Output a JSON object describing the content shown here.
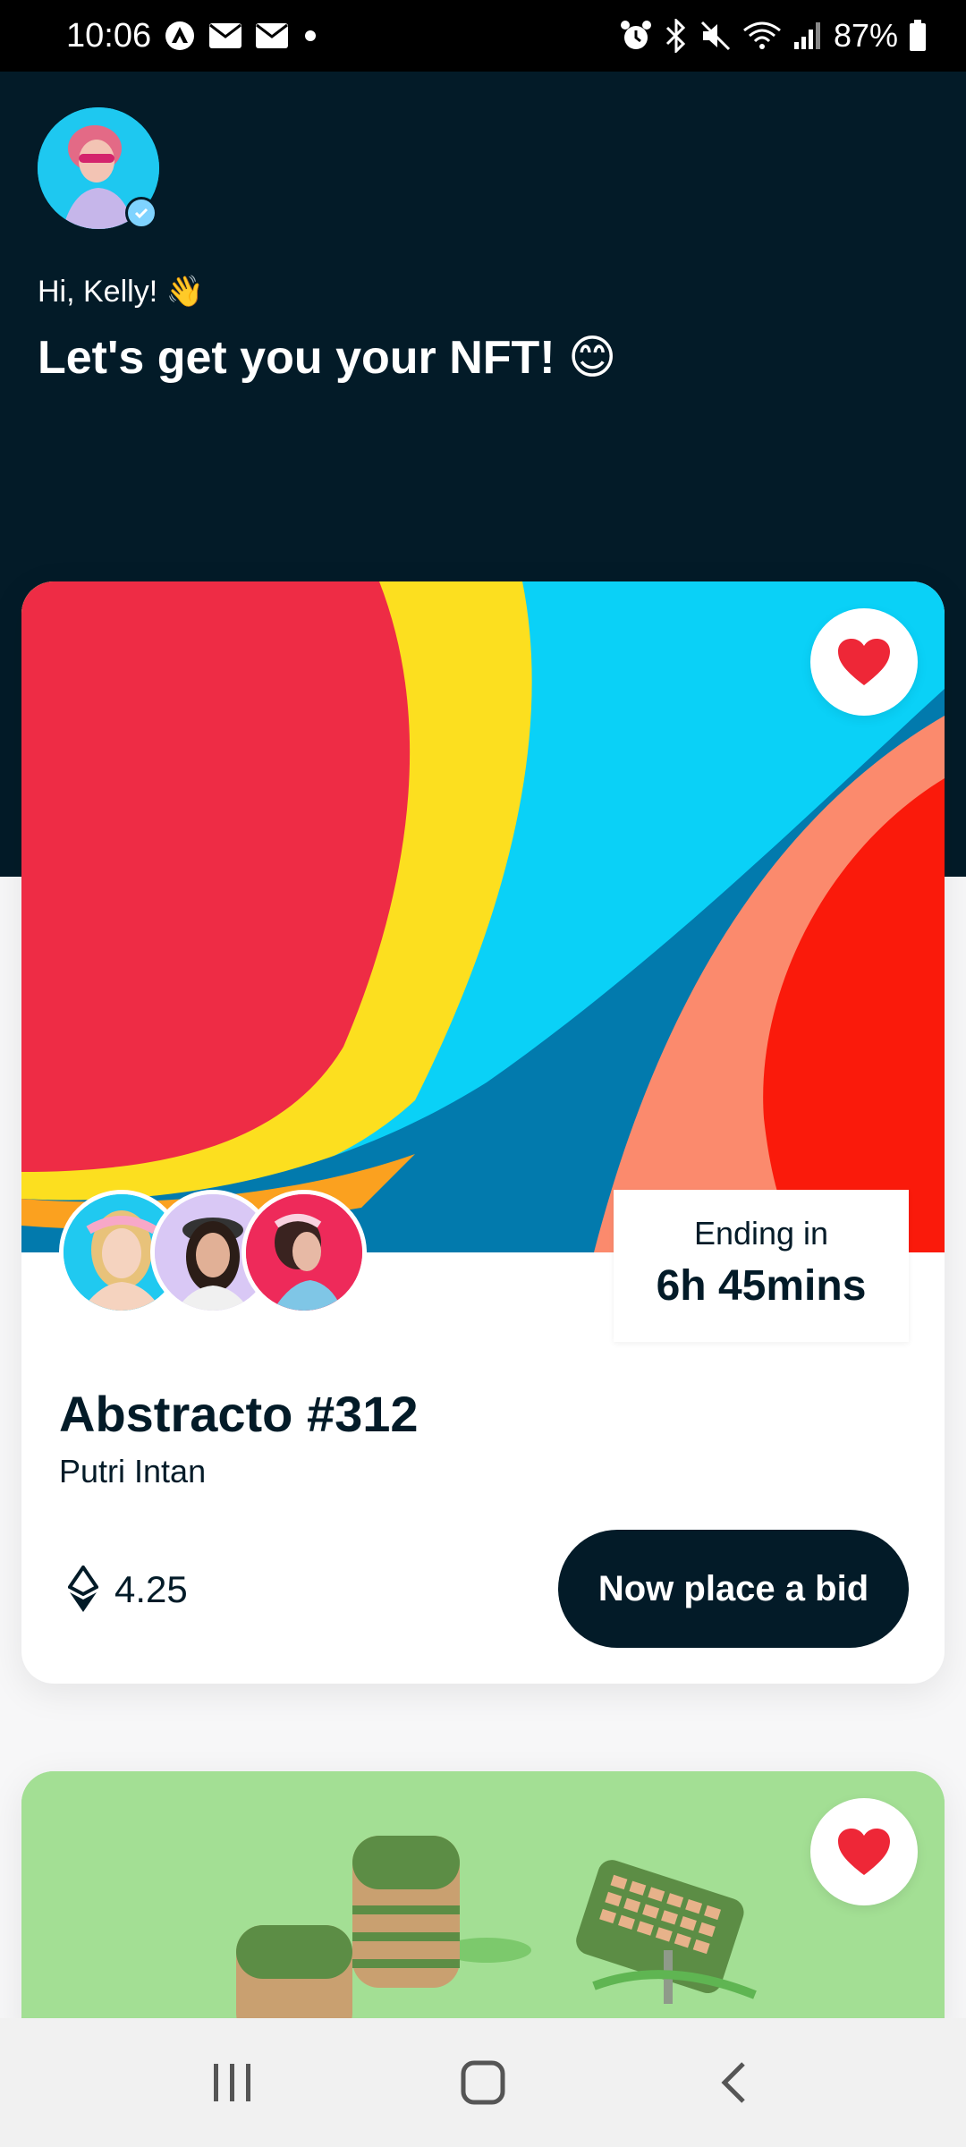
{
  "status_bar": {
    "time": "10:06",
    "battery": "87%"
  },
  "header": {
    "greeting": "Hi, Kelly! 👋",
    "headline": "Let's get you your NFT! 😊"
  },
  "featured_card": {
    "ending_label": "Ending in",
    "ending_value": "6h 45mins",
    "title": "Abstracto #312",
    "author": "Putri Intan",
    "price": "4.25",
    "bid_button": "Now place a bid",
    "owners_count": 3
  },
  "colors": {
    "dark": "#031b28",
    "heart": "#ee2737",
    "card2_bg": "#a3df94"
  },
  "icons": [
    "alarm-icon",
    "bluetooth-icon",
    "mute-icon",
    "wifi-icon",
    "signal-icon",
    "battery-icon",
    "heart-icon",
    "ethereum-icon",
    "recents-icon",
    "home-icon",
    "back-icon"
  ]
}
